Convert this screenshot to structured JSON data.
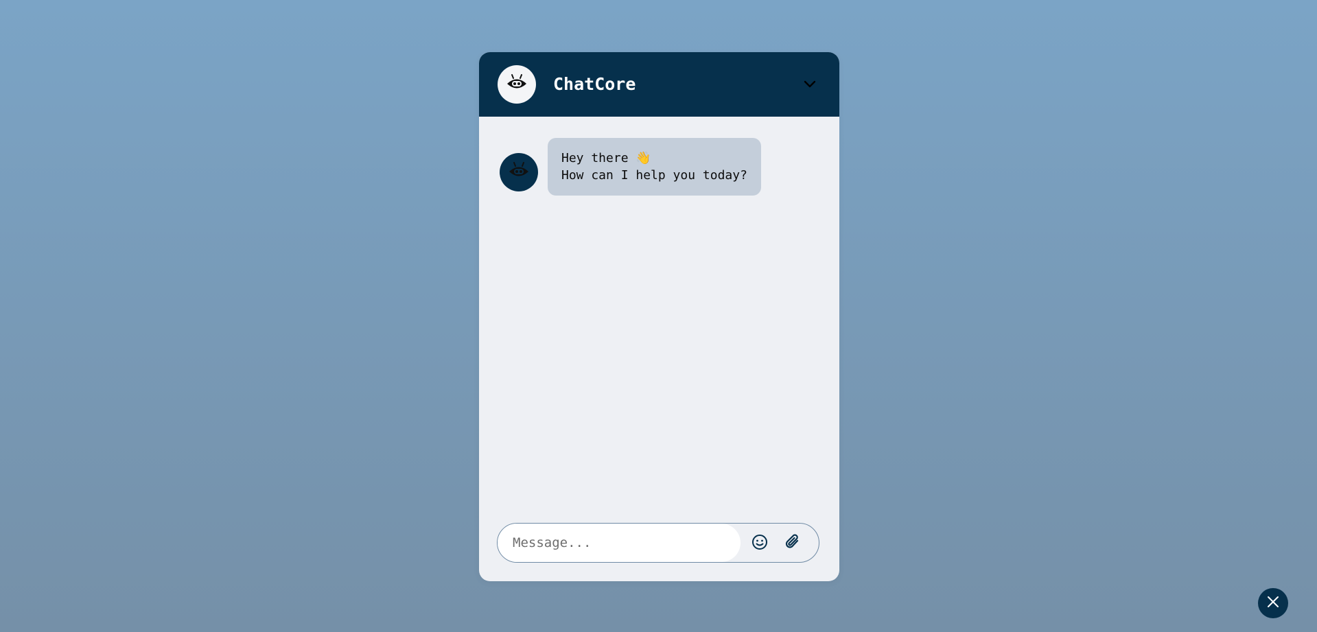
{
  "header": {
    "title": "ChatCore",
    "avatar_icon": "robot-icon",
    "toggle_icon": "chevron-down-icon"
  },
  "messages": [
    {
      "sender": "bot",
      "avatar_icon": "robot-icon",
      "text": "Hey there 👋\nHow can I help you today?"
    }
  ],
  "composer": {
    "placeholder": "Message...",
    "value": "",
    "emoji_icon": "smile-icon",
    "attach_icon": "paperclip-icon"
  },
  "fab": {
    "icon": "close-icon"
  },
  "colors": {
    "header_bg": "#06304c",
    "panel_bg": "#eef0f4",
    "bubble_bg": "#c4ceda",
    "page_bg_top": "#7ba4c6",
    "page_bg_bottom": "#7590a8"
  }
}
